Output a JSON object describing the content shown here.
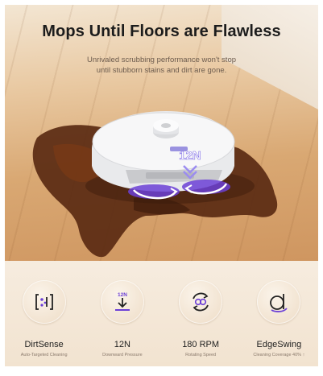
{
  "hero": {
    "title": "Mops Until Floors are Flawless",
    "subtitle_line1": "Unrivaled scrubbing performance won't stop",
    "subtitle_line2": "until stubborn stains and dirt are gone.",
    "robot_pressure_label": "12N"
  },
  "features": [
    {
      "name": "DirtSense",
      "sub": "Auto-Targeted Cleaning",
      "icon": "dirt-sense-icon"
    },
    {
      "name": "12N",
      "sub": "Downward Pressure",
      "icon": "downward-pressure-icon",
      "icon_text": "12N"
    },
    {
      "name": "180 RPM",
      "sub": "Rotating Speed",
      "icon": "rotating-speed-icon"
    },
    {
      "name": "EdgeSwing",
      "sub": "Cleaning Coverage 40% ↑",
      "icon": "edge-swing-icon"
    }
  ],
  "colors": {
    "accent": "#6b3fd6",
    "background": "#f4e5d3",
    "spill": "#5a2a12"
  }
}
